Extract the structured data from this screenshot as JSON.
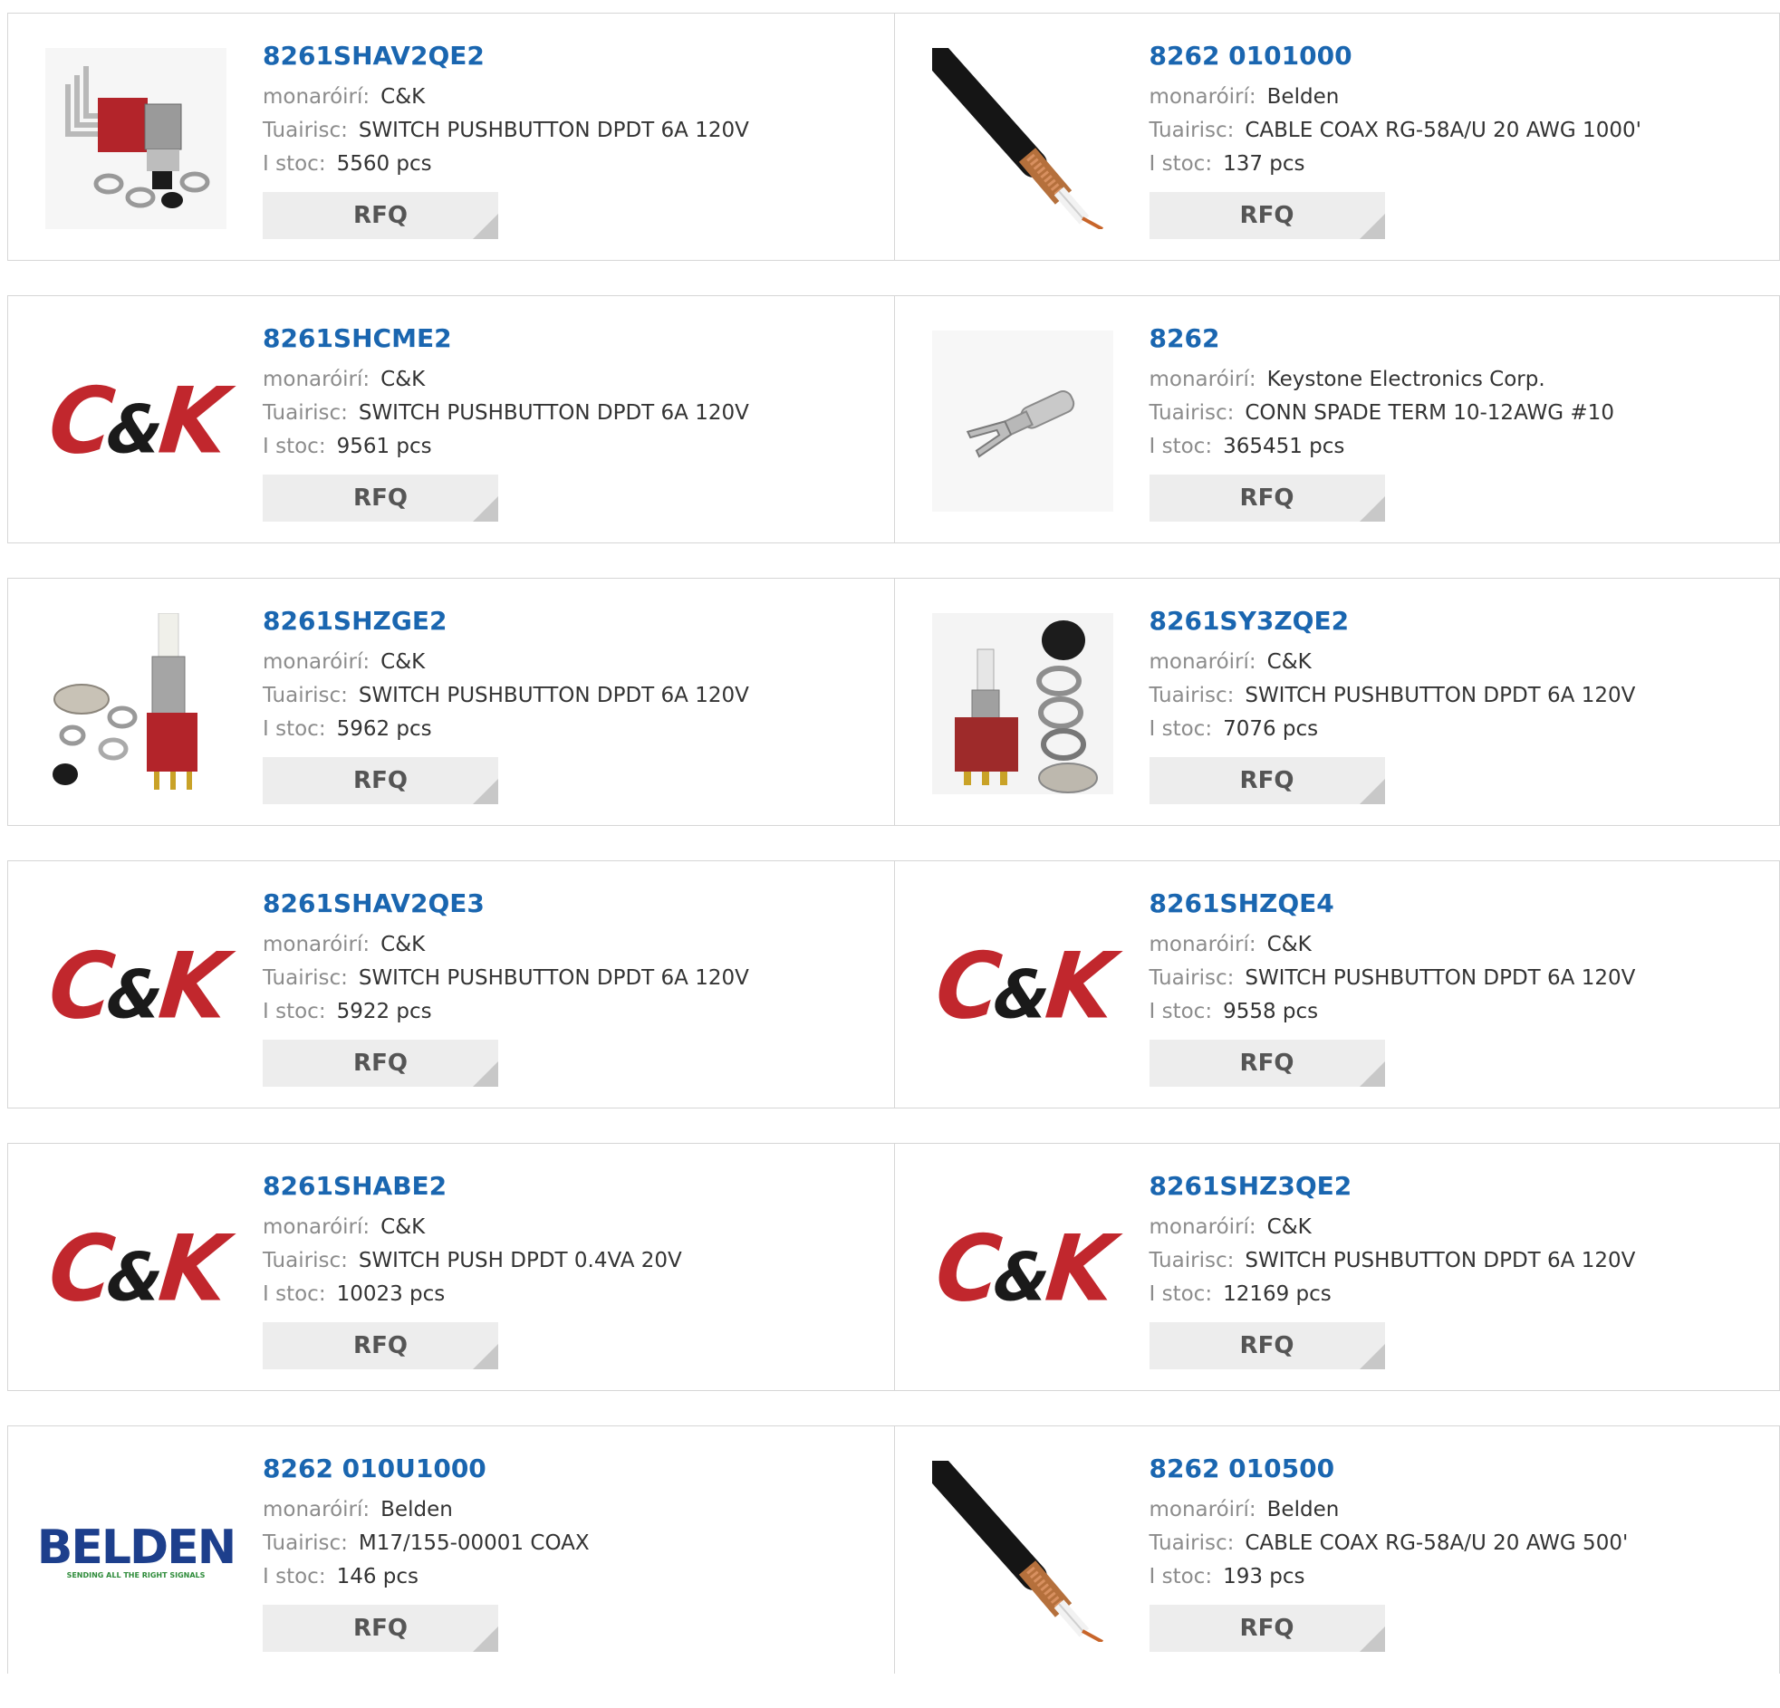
{
  "labels": {
    "manufacturer": "monaróirí:",
    "description": "Tuairisc:",
    "stock": "I stoc:",
    "rfq": "RFQ"
  },
  "products": [
    {
      "pn": "8261SHAV2QE2",
      "mfr": "C&K",
      "desc": "SWITCH PUSHBUTTON DPDT 6A 120V",
      "stock": "5560 pcs",
      "image": "pushbutton-switch-right-angle-image"
    },
    {
      "pn": "8262 0101000",
      "mfr": "Belden",
      "desc": "CABLE COAX RG-58A/U 20 AWG 1000'",
      "stock": "137 pcs",
      "image": "coax-cable-image"
    },
    {
      "pn": "8261SHCME2",
      "mfr": "C&K",
      "desc": "SWITCH PUSHBUTTON DPDT 6A 120V",
      "stock": "9561 pcs",
      "image": "ck-logo"
    },
    {
      "pn": "8262",
      "mfr": "Keystone Electronics Corp.",
      "desc": "CONN SPADE TERM 10-12AWG #10",
      "stock": "365451 pcs",
      "image": "spade-terminal-image"
    },
    {
      "pn": "8261SHZGE2",
      "mfr": "C&K",
      "desc": "SWITCH PUSHBUTTON DPDT 6A 120V",
      "stock": "5962 pcs",
      "image": "pushbutton-switch-image"
    },
    {
      "pn": "8261SY3ZQE2",
      "mfr": "C&K",
      "desc": "SWITCH PUSHBUTTON DPDT 6A 120V",
      "stock": "7076 pcs",
      "image": "pushbutton-switch-hardware-image"
    },
    {
      "pn": "8261SHAV2QE3",
      "mfr": "C&K",
      "desc": "SWITCH PUSHBUTTON DPDT 6A 120V",
      "stock": "5922 pcs",
      "image": "ck-logo"
    },
    {
      "pn": "8261SHZQE4",
      "mfr": "C&K",
      "desc": "SWITCH PUSHBUTTON DPDT 6A 120V",
      "stock": "9558 pcs",
      "image": "ck-logo"
    },
    {
      "pn": "8261SHABE2",
      "mfr": "C&K",
      "desc": "SWITCH PUSH DPDT 0.4VA 20V",
      "stock": "10023 pcs",
      "image": "ck-logo"
    },
    {
      "pn": "8261SHZ3QE2",
      "mfr": "C&K",
      "desc": "SWITCH PUSHBUTTON DPDT 6A 120V",
      "stock": "12169 pcs",
      "image": "ck-logo"
    },
    {
      "pn": "8262 010U1000",
      "mfr": "Belden",
      "desc": "M17/155-00001 COAX",
      "stock": "146 pcs",
      "image": "belden-logo"
    },
    {
      "pn": "8262 010500",
      "mfr": "Belden",
      "desc": "CABLE COAX RG-58A/U 20 AWG 500'",
      "stock": "193 pcs",
      "image": "coax-cable-image"
    }
  ],
  "logos": {
    "ck": {
      "c": "C",
      "amp": "&",
      "k": "K"
    },
    "belden": {
      "word": "BELDEN",
      "tagline": "SENDING ALL THE RIGHT SIGNALS"
    }
  }
}
